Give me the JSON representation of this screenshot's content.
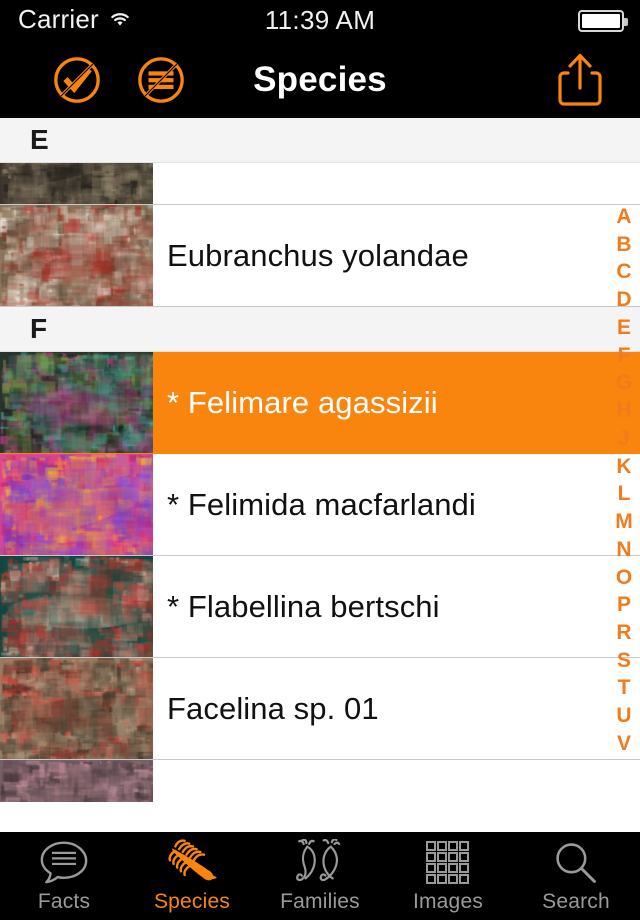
{
  "status_bar": {
    "carrier": "Carrier",
    "wifi_icon": "wifi-icon",
    "time": "11:39 AM",
    "battery_icon": "battery-full-icon"
  },
  "nav_bar": {
    "title": "Species",
    "left_buttons": [
      {
        "name": "no-checkmark-icon",
        "label": "Clear selection"
      },
      {
        "name": "no-list-icon",
        "label": "Clear filter"
      }
    ],
    "right_button": {
      "name": "share-icon",
      "label": "Share"
    }
  },
  "list": {
    "sections": [
      {
        "header": "E",
        "rows": [
          {
            "label": "",
            "partial": "top",
            "selected": false,
            "thumb": "nudibranch-thumb-1"
          },
          {
            "label": "Eubranchus yolandae",
            "partial": "",
            "selected": false,
            "thumb": "nudibranch-thumb-2"
          }
        ]
      },
      {
        "header": "F",
        "rows": [
          {
            "label": "* Felimare agassizii",
            "partial": "",
            "selected": true,
            "thumb": "nudibranch-thumb-3"
          },
          {
            "label": "* Felimida macfarlandi",
            "partial": "",
            "selected": false,
            "thumb": "nudibranch-thumb-4"
          },
          {
            "label": "* Flabellina bertschi",
            "partial": "",
            "selected": false,
            "thumb": "nudibranch-thumb-5"
          },
          {
            "label": "Facelina sp. 01",
            "partial": "",
            "selected": false,
            "thumb": "nudibranch-thumb-6"
          },
          {
            "label": "",
            "partial": "bottom",
            "selected": false,
            "thumb": "nudibranch-thumb-7"
          }
        ]
      }
    ]
  },
  "index_strip": {
    "letters": [
      "A",
      "B",
      "C",
      "D",
      "E",
      "F",
      "G",
      "H",
      "J",
      "K",
      "L",
      "M",
      "N",
      "O",
      "P",
      "R",
      "S",
      "T",
      "U",
      "V"
    ]
  },
  "tab_bar": {
    "tabs": [
      {
        "label": "Facts",
        "icon": "speech-bubble-lines-icon",
        "active": false
      },
      {
        "label": "Species",
        "icon": "nudibranch-icon",
        "active": true
      },
      {
        "label": "Families",
        "icon": "two-nudibranchs-icon",
        "active": false
      },
      {
        "label": "Images",
        "icon": "grid-icon",
        "active": false
      },
      {
        "label": "Search",
        "icon": "magnifier-icon",
        "active": false
      }
    ]
  },
  "colors": {
    "accent": "#f9850f",
    "index_letter": "#f07c1b",
    "bar_background": "#000000",
    "section_header_bg": "#f4f4f4",
    "tab_inactive": "#9a9a9a"
  }
}
